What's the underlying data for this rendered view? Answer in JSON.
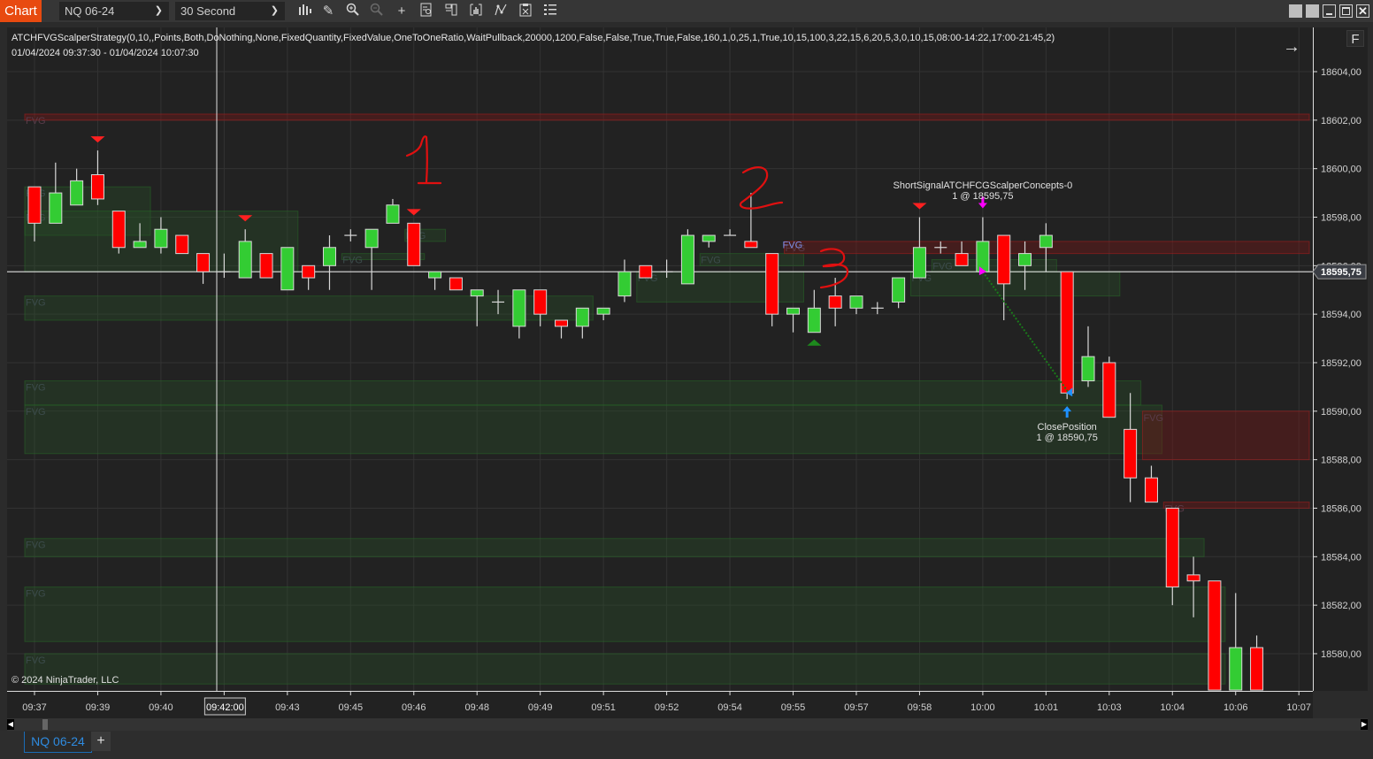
{
  "toolbar": {
    "chart_tab_label": "Chart",
    "instrument": "NQ 06-24",
    "interval": "30 Second",
    "icons": [
      "bar-type-icon",
      "drawing-tool-icon",
      "zoom-in-icon",
      "zoom-out-icon",
      "crosshair-icon",
      "data-box-icon",
      "chart-trader-icon",
      "indicators-icon",
      "strategies-icon",
      "properties-icon",
      "list-icon"
    ]
  },
  "window_controls": [
    "tile-1",
    "tile-2",
    "minimize",
    "maximize",
    "close"
  ],
  "chart": {
    "strategy_label": "ATCHFVGScalperStrategy(0,10,,Points,Both,DoNothing,None,FixedQuantity,FixedValue,OneToOneRatio,WaitPullback,20000,1200,False,False,True,True,False,160,1,0,25,1,True,10,15,100,3,22,15,6,20,5,3,0,10,15,08:00-14:22,17:00-21:45,2)",
    "date_range": "01/04/2024 09:37:30 - 01/04/2024 10:07:30",
    "copyright": "© 2024 NinjaTrader, LLC",
    "f_button": "F",
    "current_price": "18595,75",
    "crosshair_time": "09:42:00",
    "colors": {
      "up": "#33cc33",
      "down": "#ff0000",
      "background": "#222222",
      "fvg_green": "#1f3a1f",
      "fvg_red": "#4a1c1c",
      "signal": "#ff00ff",
      "close_marker": "#1e90ff"
    },
    "annotations": {
      "entry_label": "ShortSignalATCHFCGScalperConcepts-0",
      "entry_detail": "1 @ 18595,75",
      "exit_label": "ClosePosition",
      "exit_detail": "1 @ 18590,75",
      "handwritten": [
        "1",
        "2",
        "3"
      ],
      "fvg_label": "FVG"
    }
  },
  "chart_data": {
    "type": "candlestick",
    "title": "NQ 06-24 30 Second",
    "ylim": [
      18578.5,
      18605.5
    ],
    "yticks": [
      "18604,00",
      "18602,00",
      "18600,00",
      "18598,00",
      "18596,00",
      "18594,00",
      "18592,00",
      "18590,00",
      "18588,00",
      "18586,00",
      "18584,00",
      "18582,00",
      "18580,00"
    ],
    "ytick_values": [
      18604,
      18602,
      18600,
      18598,
      18596,
      18594,
      18592,
      18590,
      18588,
      18586,
      18584,
      18582,
      18580
    ],
    "xticks": [
      "09:37",
      "09:39",
      "09:40",
      "09:42:00",
      "09:43",
      "09:45",
      "09:46",
      "09:48",
      "09:49",
      "09:51",
      "09:52",
      "09:54",
      "09:55",
      "09:57",
      "09:58",
      "10:00",
      "10:01",
      "10:03",
      "10:04",
      "10:06",
      "10:07"
    ],
    "xtick_bar_index": [
      0,
      3,
      6,
      9,
      12,
      15,
      18,
      21,
      24,
      27,
      30,
      33,
      36,
      39,
      42,
      45,
      48,
      51,
      54,
      57,
      60
    ],
    "candles": [
      [
        18599.25,
        18599.25,
        18597.0,
        18597.75
      ],
      [
        18597.75,
        18600.25,
        18597.75,
        18599.0
      ],
      [
        18598.5,
        18600.0,
        18598.5,
        18599.5
      ],
      [
        18599.75,
        18600.75,
        18598.5,
        18598.75
      ],
      [
        18598.25,
        18598.25,
        18596.5,
        18596.75
      ],
      [
        18596.75,
        18597.75,
        18596.75,
        18597.0
      ],
      [
        18596.75,
        18598.0,
        18596.5,
        18597.5
      ],
      [
        18597.25,
        18597.25,
        18596.5,
        18596.5
      ],
      [
        18596.5,
        18596.5,
        18595.25,
        18595.75
      ],
      [
        18595.75,
        18596.5,
        18595.5,
        18595.75
      ],
      [
        18595.5,
        18597.5,
        18595.5,
        18597.0
      ],
      [
        18596.5,
        18596.5,
        18595.5,
        18595.5
      ],
      [
        18595.0,
        18596.75,
        18595.0,
        18596.75
      ],
      [
        18596.0,
        18596.0,
        18595.0,
        18595.5
      ],
      [
        18596.0,
        18597.25,
        18595.0,
        18596.75
      ],
      [
        18597.25,
        18597.5,
        18597.0,
        18597.25
      ],
      [
        18596.75,
        18597.5,
        18595.0,
        18597.5
      ],
      [
        18597.75,
        18598.75,
        18597.75,
        18598.5
      ],
      [
        18597.75,
        18597.75,
        18596.0,
        18596.0
      ],
      [
        18595.5,
        18595.75,
        18595.0,
        18595.75
      ],
      [
        18595.5,
        18595.5,
        18595.0,
        18595.0
      ],
      [
        18594.75,
        18595.0,
        18593.5,
        18595.0
      ],
      [
        18594.5,
        18595.0,
        18594.0,
        18594.5
      ],
      [
        18593.5,
        18595.0,
        18593.0,
        18595.0
      ],
      [
        18595.0,
        18595.0,
        18593.5,
        18594.0
      ],
      [
        18593.75,
        18593.75,
        18593.0,
        18593.5
      ],
      [
        18593.5,
        18594.25,
        18593.0,
        18594.25
      ],
      [
        18594.0,
        18594.25,
        18593.75,
        18594.25
      ],
      [
        18594.75,
        18596.25,
        18594.5,
        18595.75
      ],
      [
        18596.0,
        18596.0,
        18595.5,
        18595.5
      ],
      [
        18595.75,
        18596.25,
        18595.5,
        18595.75
      ],
      [
        18595.25,
        18597.5,
        18595.25,
        18597.25
      ],
      [
        18597.0,
        18597.25,
        18596.75,
        18597.25
      ],
      [
        18597.25,
        18597.5,
        18597.25,
        18597.25
      ],
      [
        18597.0,
        18599.0,
        18597.0,
        18596.75
      ],
      [
        18596.5,
        18596.5,
        18593.5,
        18594.0
      ],
      [
        18594.0,
        18594.25,
        18593.25,
        18594.25
      ],
      [
        18593.25,
        18595.0,
        18593.25,
        18594.25
      ],
      [
        18594.75,
        18595.5,
        18593.5,
        18594.25
      ],
      [
        18594.25,
        18594.75,
        18594.0,
        18594.75
      ],
      [
        18594.25,
        18594.5,
        18594.0,
        18594.25
      ],
      [
        18594.5,
        18595.5,
        18594.25,
        18595.5
      ],
      [
        18595.5,
        18598.0,
        18595.5,
        18596.75
      ],
      [
        18596.75,
        18597.0,
        18596.5,
        18596.75
      ],
      [
        18596.5,
        18597.0,
        18596.0,
        18596.0
      ],
      [
        18595.75,
        18598.0,
        18595.75,
        18597.0
      ],
      [
        18597.25,
        18597.25,
        18593.75,
        18595.25
      ],
      [
        18596.0,
        18597.0,
        18595.0,
        18596.5
      ],
      [
        18596.75,
        18597.75,
        18595.75,
        18597.25
      ],
      [
        18595.75,
        18595.75,
        18590.5,
        18590.75
      ],
      [
        18591.25,
        18593.5,
        18591.0,
        18592.25
      ],
      [
        18592.0,
        18592.25,
        18589.75,
        18589.75
      ],
      [
        18589.25,
        18590.75,
        18586.25,
        18587.25
      ],
      [
        18587.25,
        18587.75,
        18586.25,
        18586.25
      ],
      [
        18586.0,
        18586.0,
        18582.0,
        18582.75
      ],
      [
        18583.25,
        18584.0,
        18581.5,
        18583.0
      ],
      [
        18583.0,
        18583.0,
        18578.5,
        18578.5
      ],
      [
        18578.5,
        18582.5,
        18578.5,
        18580.25
      ],
      [
        18580.25,
        18580.75,
        18578.5,
        18578.5
      ]
    ],
    "candle_fields": [
      "open",
      "high",
      "low",
      "close"
    ],
    "fvg_zones": [
      {
        "color": "red",
        "top": 18602.25,
        "bottom": 18602.0,
        "from_bar": 0,
        "label": "FVG"
      },
      {
        "color": "green",
        "top": 18599.25,
        "bottom": 18597.25,
        "from_bar": 0,
        "to_bar": 5,
        "label": "FVG"
      },
      {
        "color": "green",
        "top": 18598.25,
        "bottom": 18595.75,
        "from_bar": 0,
        "to_bar": 12,
        "label": "FVG"
      },
      {
        "color": "green",
        "top": 18596.5,
        "bottom": 18596.25,
        "from_bar": 15,
        "to_bar": 18,
        "label": "FVG"
      },
      {
        "color": "green",
        "top": 18597.5,
        "bottom": 18597.0,
        "from_bar": 18,
        "to_bar": 19,
        "label": "FVG"
      },
      {
        "color": "green",
        "top": 18594.75,
        "bottom": 18593.75,
        "from_bar": 0,
        "to_bar": 26,
        "label": "FVG"
      },
      {
        "color": "green",
        "top": 18596.5,
        "bottom": 18596.0,
        "from_bar": 32,
        "to_bar": 36,
        "label": "FVG"
      },
      {
        "color": "green",
        "top": 18595.75,
        "bottom": 18594.5,
        "from_bar": 29,
        "to_bar": 36,
        "label": "FVG"
      },
      {
        "color": "red",
        "top": 18597.0,
        "bottom": 18596.5,
        "from_bar": 36,
        "label": "FVG"
      },
      {
        "color": "green",
        "top": 18596.25,
        "bottom": 18595.75,
        "from_bar": 43,
        "to_bar": 48,
        "label": "FVG"
      },
      {
        "color": "green",
        "top": 18595.75,
        "bottom": 18594.75,
        "from_bar": 42,
        "to_bar": 51,
        "label": "FVG"
      },
      {
        "color": "green",
        "top": 18591.25,
        "bottom": 18590.25,
        "from_bar": 0,
        "to_bar": 52,
        "label": "FVG"
      },
      {
        "color": "green",
        "top": 18590.25,
        "bottom": 18588.25,
        "from_bar": 0,
        "to_bar": 53,
        "label": "FVG"
      },
      {
        "color": "red",
        "top": 18590.0,
        "bottom": 18588.0,
        "from_bar": 53,
        "label": "FVG"
      },
      {
        "color": "red",
        "top": 18586.25,
        "bottom": 18586.0,
        "from_bar": 54,
        "label": "FVG"
      },
      {
        "color": "green",
        "top": 18584.75,
        "bottom": 18584.0,
        "from_bar": 0,
        "to_bar": 55,
        "label": "FVG"
      },
      {
        "color": "green",
        "top": 18582.75,
        "bottom": 18580.5,
        "from_bar": 0,
        "to_bar": 56,
        "label": "FVG"
      },
      {
        "color": "green",
        "top": 18580.0,
        "bottom": 18578.75,
        "from_bar": 0,
        "to_bar": 56,
        "label": "FVG"
      }
    ],
    "short_markers_bar": [
      3,
      10,
      18,
      42
    ],
    "long_markers_bar": [
      37
    ],
    "entry": {
      "bar": 45,
      "price": 18595.75
    },
    "exit": {
      "bar": 49,
      "price": 18590.75
    },
    "last_price": 18595.75
  }
}
